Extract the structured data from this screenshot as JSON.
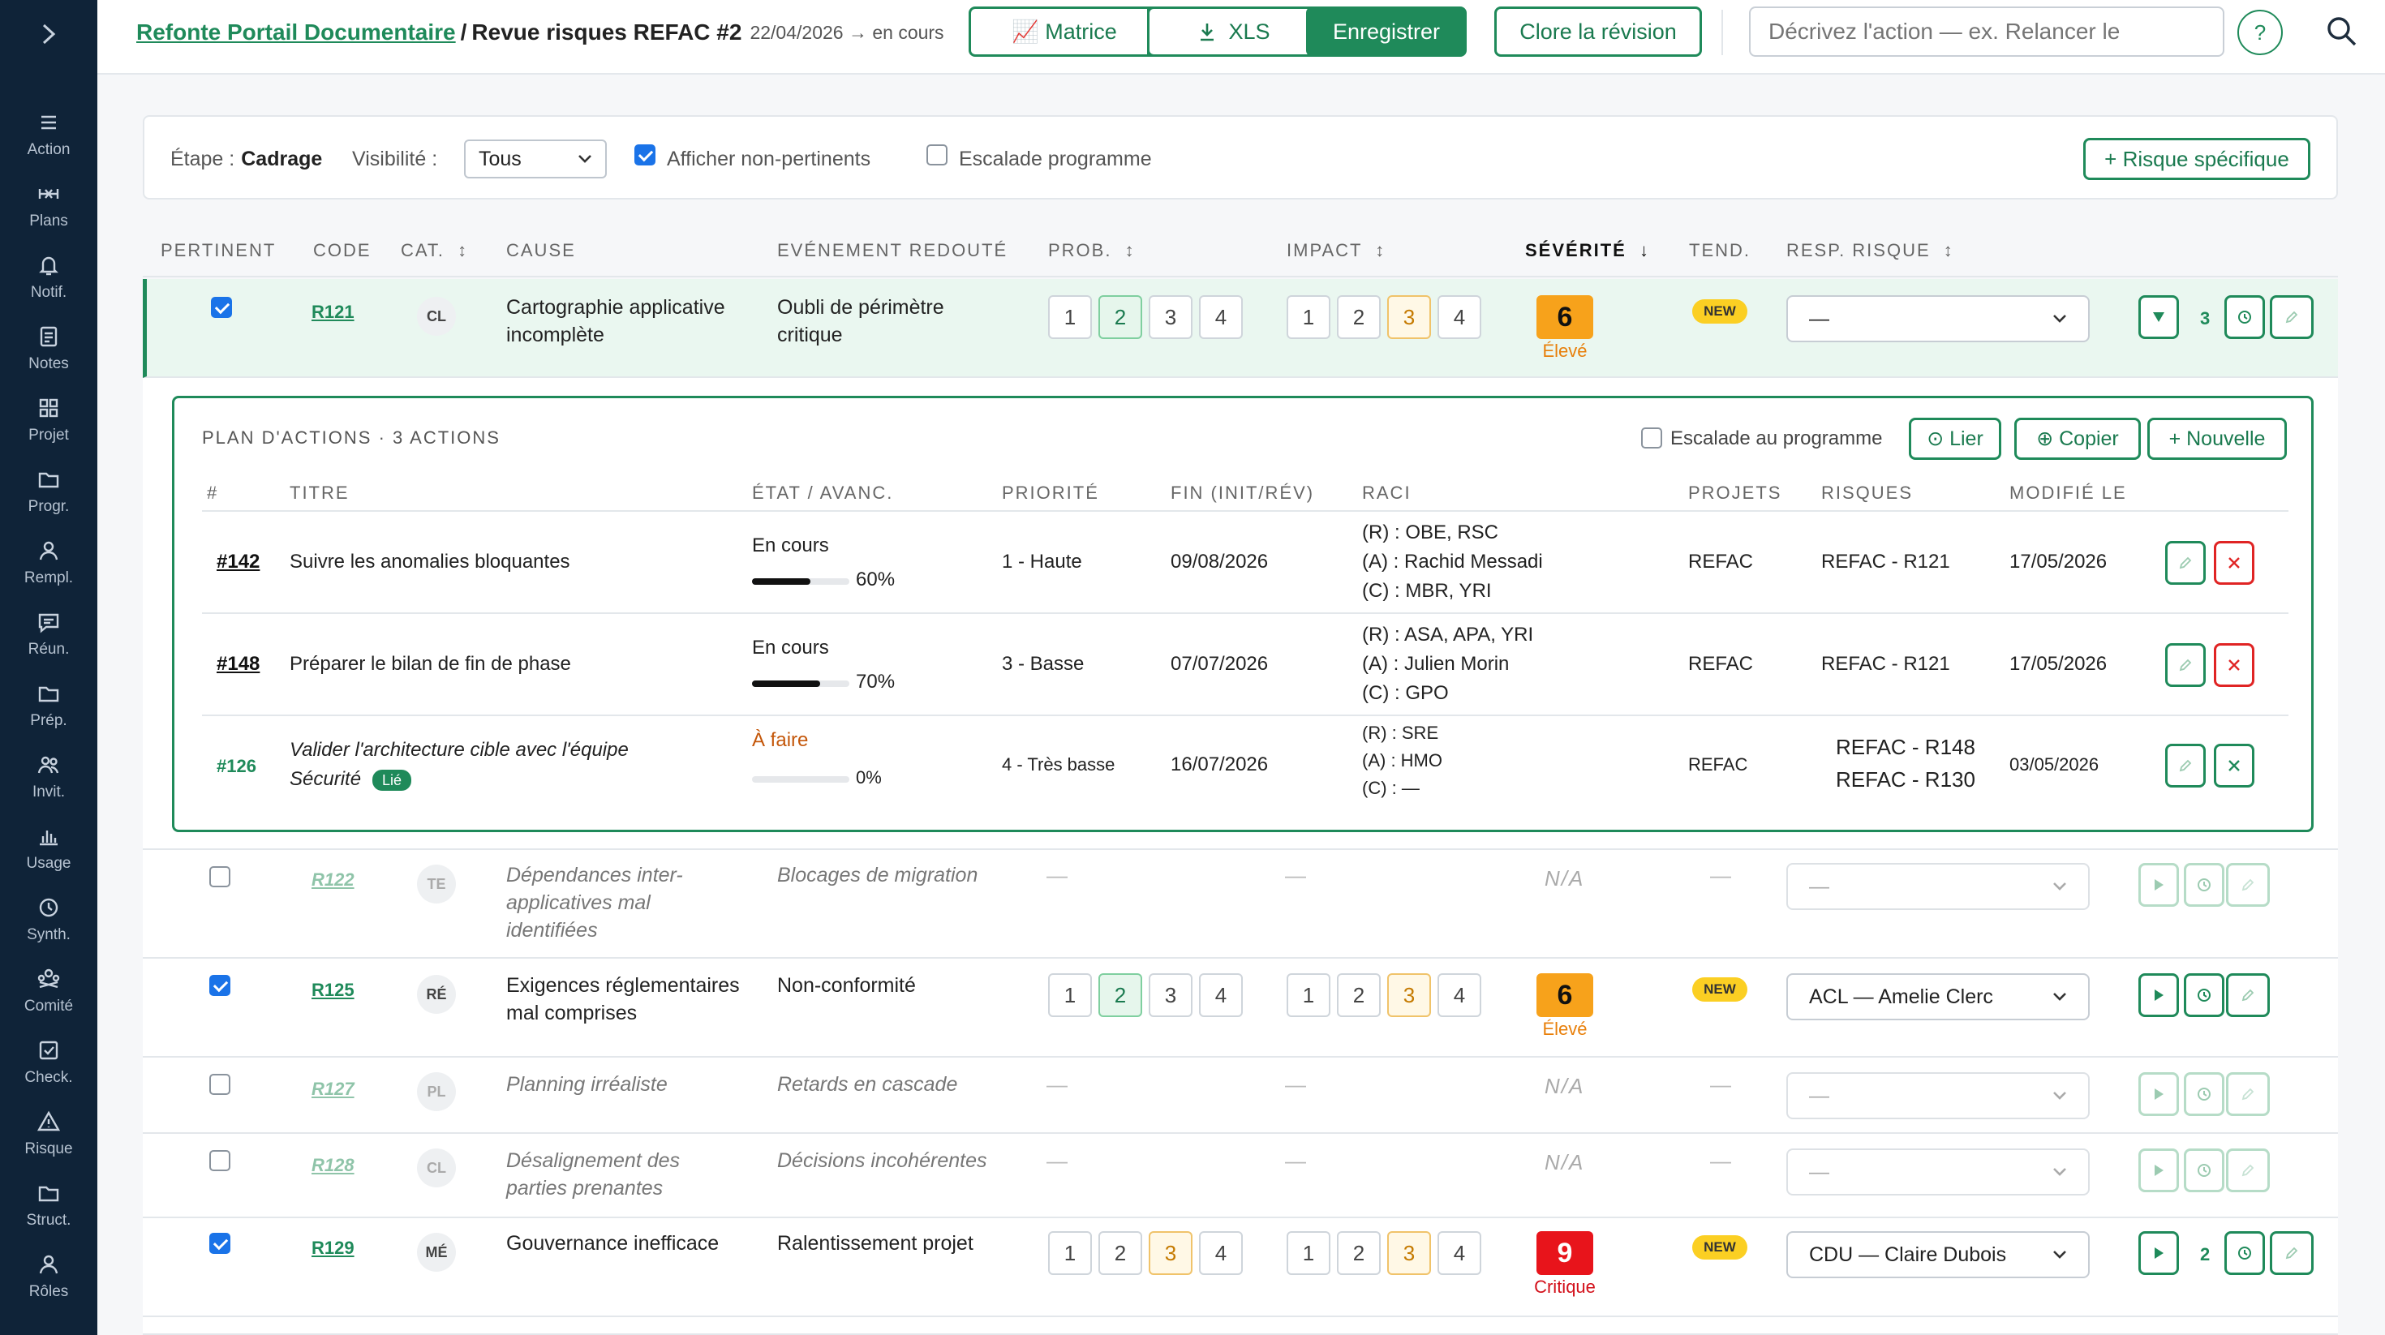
{
  "sidebar": {
    "items": [
      {
        "label": "Action",
        "icon": "action-icon"
      },
      {
        "label": "Plans",
        "icon": "plans-icon"
      },
      {
        "label": "Notif.",
        "icon": "bell-icon"
      },
      {
        "label": "Notes",
        "icon": "notes-icon"
      },
      {
        "label": "Projet",
        "icon": "grid-icon"
      },
      {
        "label": "Progr.",
        "icon": "folder-icon"
      },
      {
        "label": "Rempl.",
        "icon": "person-icon"
      },
      {
        "label": "Réun.",
        "icon": "chat-icon"
      },
      {
        "label": "Prép.",
        "icon": "folder-icon"
      },
      {
        "label": "Invit.",
        "icon": "people-icon"
      },
      {
        "label": "Usage",
        "icon": "bar-chart-icon"
      },
      {
        "label": "Synth.",
        "icon": "clock-icon"
      },
      {
        "label": "Comité",
        "icon": "committee-icon"
      },
      {
        "label": "Check.",
        "icon": "checklist-icon"
      },
      {
        "label": "Risque",
        "icon": "warning-icon"
      },
      {
        "label": "Struct.",
        "icon": "folder-icon"
      },
      {
        "label": "Rôles",
        "icon": "person-icon"
      }
    ]
  },
  "header": {
    "project": "Refonte Portail Documentaire",
    "separator": "/",
    "review": "Revue risques REFAC #2",
    "meta": "22/04/2026 → en cours",
    "matrix_label": "📈 Matrice",
    "xls_label": "XLS",
    "save_label": "Enregistrer",
    "close_label": "Clore la révision",
    "action_placeholder": "Décrivez l'action — ex. Relancer le",
    "help_label": "?"
  },
  "filters": {
    "stage_label": "Étape :",
    "stage_value": "Cadrage",
    "visibility_label": "Visibilité :",
    "visibility_value": "Tous",
    "show_irrelevant_label": "Afficher non-pertinents",
    "show_irrelevant_checked": true,
    "escalate_label": "Escalade programme",
    "escalate_checked": false,
    "add_risk_label": "+ Risque spécifique"
  },
  "columns": {
    "pertinent": "PERTINENT",
    "code": "CODE",
    "cat": "CAT.",
    "cause": "CAUSE",
    "event": "EVÉNEMENT REDOUTÉ",
    "prob": "PROB.",
    "impact": "IMPACT",
    "severity": "SÉVÉRITÉ",
    "trend": "TEND.",
    "owner": "RESP. RISQUE",
    "sort_icon": "↕",
    "sort_desc": "↓"
  },
  "rows": [
    {
      "code": "R121",
      "cat": "CL",
      "cause": [
        "Cartographie applicative",
        "incomplète"
      ],
      "event": [
        "Oubli de périmètre",
        "critique"
      ],
      "prob": 2,
      "impact": 3,
      "severity": "6",
      "severity_label": "Élevé",
      "trend": "NEW",
      "owner": "—",
      "count": "3",
      "checked": true
    },
    {
      "code": "R122",
      "cat": "TE",
      "cause": [
        "Dépendances inter-",
        "applicatives mal",
        "identifiées"
      ],
      "event": [
        "Blocages de migration"
      ],
      "prob_text": "—",
      "impact_text": "—",
      "severity": "N/A",
      "trend_text": "—",
      "owner": "—",
      "checked": false
    },
    {
      "code": "R125",
      "cat": "RÉ",
      "cause": [
        "Exigences réglementaires",
        "mal comprises"
      ],
      "event": [
        "Non-conformité"
      ],
      "prob": 2,
      "impact": 3,
      "severity": "6",
      "severity_label": "Élevé",
      "trend": "NEW",
      "owner": "ACL — Amelie Clerc",
      "checked": true
    },
    {
      "code": "R127",
      "cat": "PL",
      "cause": [
        "Planning irréaliste"
      ],
      "event": [
        "Retards en cascade"
      ],
      "prob_text": "—",
      "impact_text": "—",
      "severity": "N/A",
      "trend_text": "—",
      "owner": "—",
      "checked": false
    },
    {
      "code": "R128",
      "cat": "CL",
      "cause": [
        "Désalignement des",
        "parties prenantes"
      ],
      "event": [
        "Décisions incohérentes"
      ],
      "prob_text": "—",
      "impact_text": "—",
      "severity": "N/A",
      "trend_text": "—",
      "owner": "—",
      "checked": false
    },
    {
      "code": "R129",
      "cat": "MÉ",
      "cause": [
        "Gouvernance inefficace"
      ],
      "event": [
        "Ralentissement projet"
      ],
      "prob": 3,
      "impact": 3,
      "severity": "9",
      "severity_label": "Critique",
      "trend": "NEW",
      "owner": "CDU — Claire Dubois",
      "count": "2",
      "checked": true
    }
  ],
  "scale": [
    "1",
    "2",
    "3",
    "4"
  ],
  "plan": {
    "title": "PLAN D'ACTIONS · 3 ACTIONS",
    "escalate_label": "Escalade au programme",
    "link_label": "⊙ Lier",
    "copy_label": "⊕ Copier",
    "new_label": "+ Nouvelle",
    "columns": {
      "num": "#",
      "title": "TITRE",
      "state": "ÉTAT / AVANC.",
      "priority": "PRIORITÉ",
      "end": "FIN (INIT/RÉV)",
      "raci": "RACI",
      "projects": "PROJETS",
      "risks": "RISQUES",
      "modified": "MODIFIÉ LE"
    },
    "actions": [
      {
        "id": "#142",
        "title": "Suivre les anomalies bloquantes",
        "title2": "",
        "state": "En cours",
        "progress": 60,
        "progress_label": "60%",
        "priority": "1 - Haute",
        "end": "09/08/2026",
        "raci": [
          "(R) : OBE, RSC",
          "(A) : Rachid Messadi",
          "(C) : MBR, YRI"
        ],
        "projects": "REFAC",
        "risks": [
          "REFAC - R121"
        ],
        "modified": "17/05/2026"
      },
      {
        "id": "#148",
        "title": "Préparer le bilan de fin de phase",
        "title2": "",
        "state": "En cours",
        "progress": 70,
        "progress_label": "70%",
        "priority": "3 - Basse",
        "end": "07/07/2026",
        "raci": [
          "(R) : ASA, APA, YRI",
          "(A) : Julien Morin",
          "(C) : GPO"
        ],
        "projects": "REFAC",
        "risks": [
          "REFAC - R121"
        ],
        "modified": "17/05/2026"
      },
      {
        "id": "#126",
        "title": "Valider l'architecture cible avec l'équipe",
        "title2": "Sécurité",
        "linked_label": "Lié",
        "state": "À faire",
        "progress": 0,
        "progress_label": "0%",
        "priority": "4 - Très basse",
        "end": "16/07/2026",
        "raci": [
          "(R) : SRE",
          "(A) : HMO",
          "(C) : —"
        ],
        "projects": "REFAC",
        "risks": [
          "REFAC - R148",
          "REFAC - R130"
        ],
        "modified": "03/05/2026"
      }
    ]
  },
  "colors": {
    "accent": "#1f8a5a",
    "sidebar": "#0f2338",
    "high": "#f7a21b",
    "critical": "#e8141b",
    "new_badge": "#fbcf23",
    "danger": "#e02424"
  }
}
